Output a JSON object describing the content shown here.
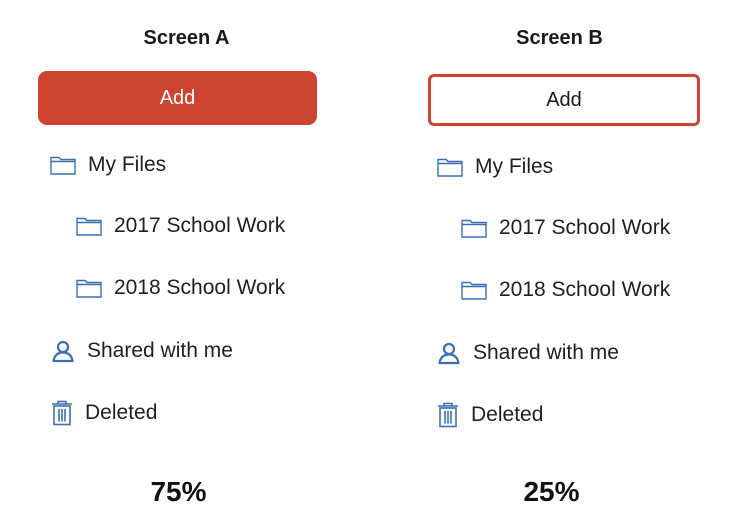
{
  "colors": {
    "accent": "#cd4530",
    "icon": "#3a6fb5"
  },
  "screen_a": {
    "title": "Screen A",
    "add_label": "Add",
    "items": [
      {
        "label": "My Files",
        "icon": "folder-icon"
      },
      {
        "label": "2017 School Work",
        "icon": "folder-icon"
      },
      {
        "label": "2018 School Work",
        "icon": "folder-icon"
      },
      {
        "label": "Shared with me",
        "icon": "person-icon"
      },
      {
        "label": "Deleted",
        "icon": "trash-icon"
      }
    ],
    "percent": "75%"
  },
  "screen_b": {
    "title": "Screen B",
    "add_label": "Add",
    "items": [
      {
        "label": "My Files",
        "icon": "folder-icon"
      },
      {
        "label": "2017 School Work",
        "icon": "folder-icon"
      },
      {
        "label": "2018 School Work",
        "icon": "folder-icon"
      },
      {
        "label": "Shared with me",
        "icon": "person-icon"
      },
      {
        "label": "Deleted",
        "icon": "trash-icon"
      }
    ],
    "percent": "25%"
  }
}
